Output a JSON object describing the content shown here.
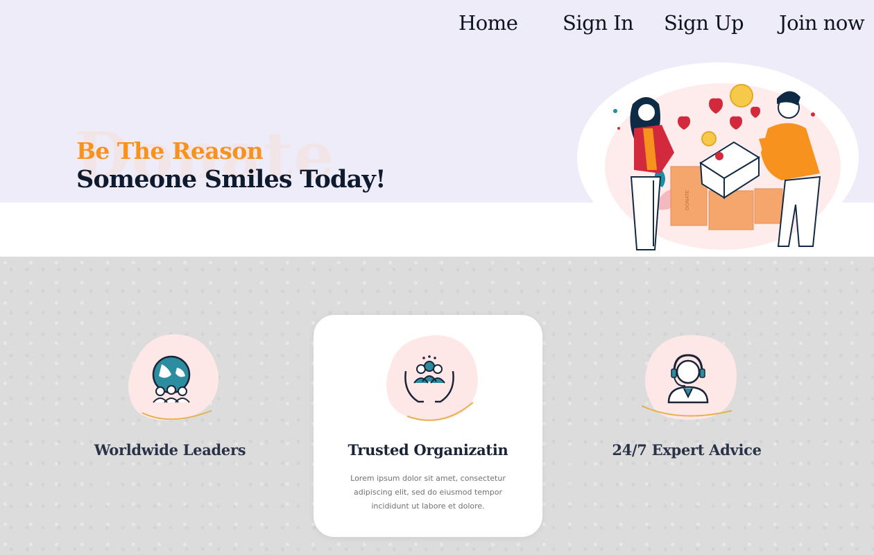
{
  "nav": {
    "items": [
      {
        "label": "Home"
      },
      {
        "label": "Sign In"
      },
      {
        "label": "Sign Up"
      },
      {
        "label": "Join now"
      }
    ]
  },
  "hero": {
    "watermark": "Donate",
    "tagline_line1": "Be The Reason",
    "tagline_line2": "Someone Smiles Today!",
    "illustration_box_label": "DONATE"
  },
  "features": {
    "cards": [
      {
        "title": "Worldwide Leaders",
        "icon": "globe-people-icon"
      },
      {
        "title": "Trusted Organizatin",
        "icon": "hands-group-icon",
        "description": "Lorem ipsum dolor sit amet, consectetur adipiscing elit, sed do eiusmod tempor incididunt ut labore et dolore."
      },
      {
        "title": "24/7 Expert Advice",
        "icon": "headset-agent-icon"
      }
    ]
  },
  "colors": {
    "hero_background": "#efecf9",
    "accent_orange": "#f7921e",
    "heading_navy": "#0e1a2e",
    "blob_pink": "#fde7e7",
    "features_background": "#dcdcdc"
  }
}
